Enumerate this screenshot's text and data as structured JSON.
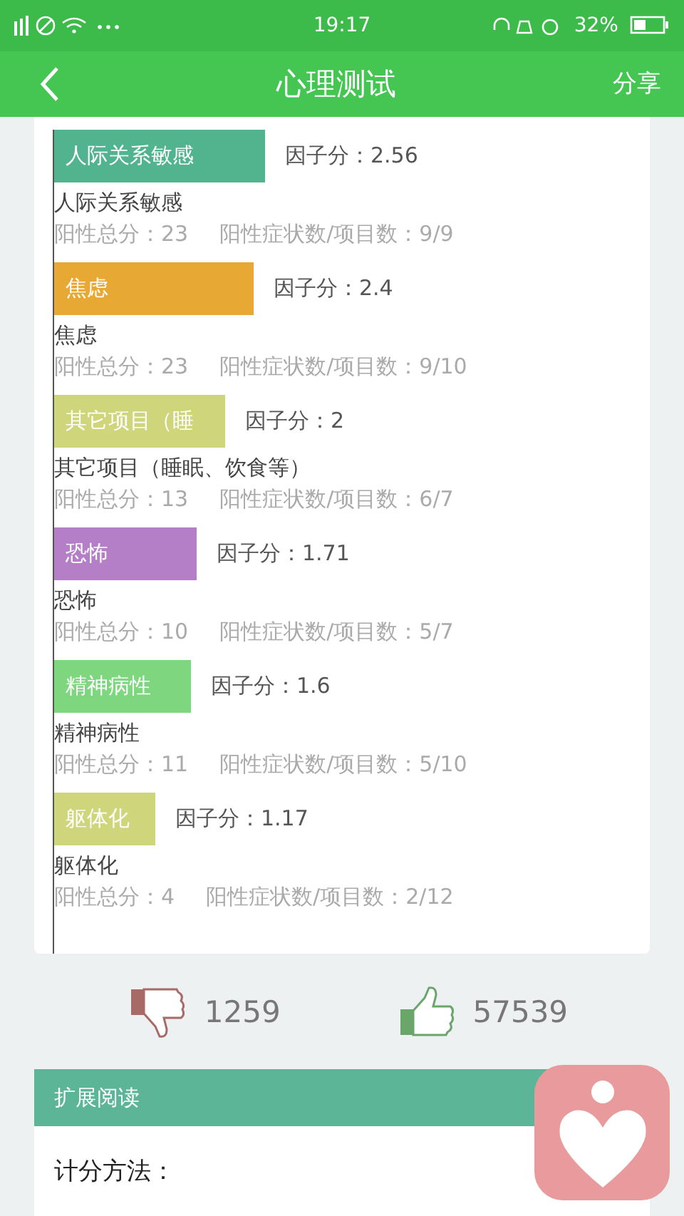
{
  "status_bar": {
    "time": "19:17",
    "battery": "32%"
  },
  "header": {
    "title": "心理测试",
    "action": "分享"
  },
  "factors": [
    {
      "bar_label": "人际关系敏感",
      "color": "#52b48f",
      "score": "因子分：2.56",
      "name": "人际关系敏感",
      "positive_total": "阳性总分：23",
      "ratio": "阳性症状数/项目数：9/9"
    },
    {
      "bar_label": "焦虑",
      "color": "#e8a834",
      "score": "因子分：2.4",
      "name": "焦虑",
      "positive_total": "阳性总分：23",
      "ratio": "阳性症状数/项目数：9/10"
    },
    {
      "bar_label": "其它项目（睡",
      "color": "#cfd57a",
      "score": "因子分：2",
      "name": "其它项目（睡眠、饮食等）",
      "positive_total": "阳性总分：13",
      "ratio": "阳性症状数/项目数：6/7"
    },
    {
      "bar_label": "恐怖",
      "color": "#b57fc7",
      "score": "因子分：1.71",
      "name": "恐怖",
      "positive_total": "阳性总分：10",
      "ratio": "阳性症状数/项目数：5/7"
    },
    {
      "bar_label": "精神病性",
      "color": "#7ed67e",
      "score": "因子分：1.6",
      "name": "精神病性",
      "positive_total": "阳性总分：11",
      "ratio": "阳性症状数/项目数：5/10"
    },
    {
      "bar_label": "躯体化",
      "color": "#cfd57a",
      "score": "因子分：1.17",
      "name": "躯体化",
      "positive_total": "阳性总分：4",
      "ratio": "阳性症状数/项目数：2/12"
    }
  ],
  "votes": {
    "dislikes": "1259",
    "likes": "57539"
  },
  "reading": {
    "title": "扩展阅读",
    "first_line": "计分方法："
  }
}
